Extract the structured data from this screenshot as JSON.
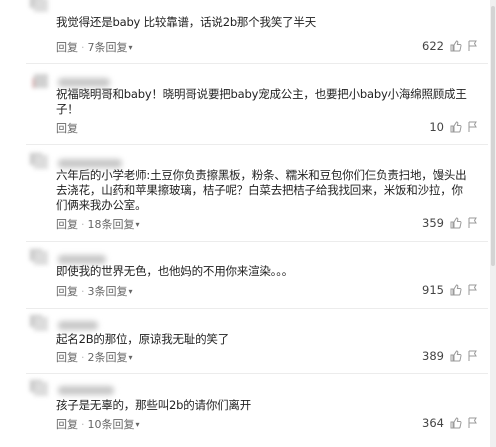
{
  "comments": [
    {
      "text": "我觉得还是baby 比较靠谱，话说2b那个我笑了半天",
      "reply_label": "回复",
      "sub_replies": "7条回复",
      "likes": "622"
    },
    {
      "text": "祝福晓明哥和baby！晓明哥说要把baby宠成公主，也要把小baby小海绵照顾成王子！",
      "reply_label": "回复",
      "likes": "10"
    },
    {
      "text": "六年后的小学老师:土豆你负责擦黑板，粉条、糯米和豆包你们仨负责扫地，馒头出去浇花，山药和苹果擦玻璃，桔子呢？白菜去把桔子给我找回来，米饭和沙拉，你们俩来我办公室。",
      "reply_label": "回复",
      "sub_replies": "18条回复",
      "likes": "359"
    },
    {
      "text": "即使我的世界无色，也他妈的不用你来渲染。。。",
      "reply_label": "回复",
      "sub_replies": "3条回复",
      "likes": "915"
    },
    {
      "text": "起名2B的那位，原谅我无耻的笑了",
      "reply_label": "回复",
      "sub_replies": "2条回复",
      "likes": "389"
    },
    {
      "text": "孩子是无辜的，那些叫2b的请你们离开",
      "reply_label": "回复",
      "sub_replies": "10条回复",
      "likes": "364"
    }
  ],
  "icons": {
    "like": "thumbs-up-icon",
    "report": "flag-icon",
    "expand": "chevron-down-icon"
  },
  "colors": {
    "text": "#222222",
    "meta": "#666666",
    "divider": "#ececec"
  }
}
